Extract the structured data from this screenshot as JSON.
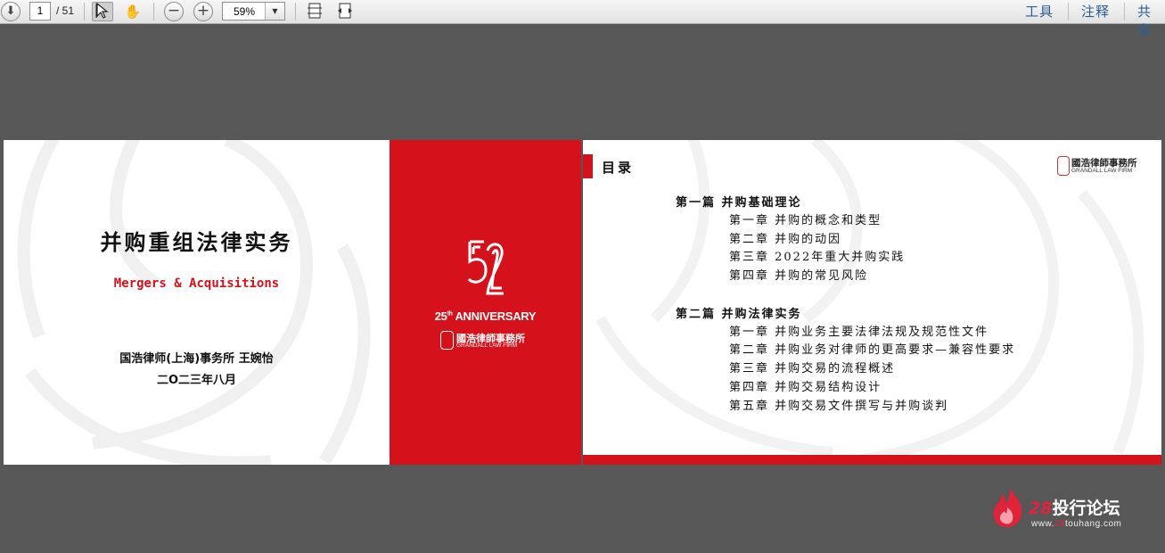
{
  "toolbar": {
    "current_page": "1",
    "total_pages": "/ 51",
    "zoom": "59%",
    "tools_label": "工具",
    "comment_label": "注释",
    "share_label": "共享"
  },
  "cover": {
    "title": "并购重组法律实务",
    "subtitle": "Mergers & Acquisitions",
    "author": "国浩律师(上海)事务所  王婉怡",
    "date": "二O二三年八月"
  },
  "spine": {
    "anniversary_number": "25",
    "anniversary_suffix": "th",
    "anniversary_word": " ANNIVERSARY",
    "firm_cn": "國浩律師事務所",
    "firm_en": "GRANDALL LAW FIRM"
  },
  "toc_page": {
    "title": "目录",
    "logo_cn": "國浩律師事務所",
    "logo_en": "GRANDALL LAW FIRM",
    "parts": [
      {
        "heading": "第一篇  并购基础理论",
        "chapters": [
          "第一章  并购的概念和类型",
          "第二章  并购的动因",
          "第三章  2022年重大并购实践",
          "第四章  并购的常见风险"
        ]
      },
      {
        "heading": "第二篇  并购法律实务",
        "chapters": [
          "第一章  并购业务主要法律法规及规范性文件",
          "第二章  并购业务对律师的更高要求—兼容性要求",
          "第三章  并购交易的流程概述",
          "第四章  并购交易结构设计",
          "第五章  并购交易文件撰写与并购谈判"
        ]
      }
    ]
  },
  "site_watermark": {
    "name_prefix": "28",
    "name_rest": "投行论坛",
    "url_pre": "www.",
    "url_hl": "28",
    "url_post": "touhang.com"
  },
  "colors": {
    "brand_red": "#d5121b",
    "background": "#575757",
    "link_blue": "#2b5e96"
  },
  "icons": [
    "download-icon",
    "select-tool-icon",
    "hand-tool-icon",
    "zoom-out-icon",
    "zoom-in-icon",
    "fit-page-icon",
    "fit-width-icon"
  ]
}
